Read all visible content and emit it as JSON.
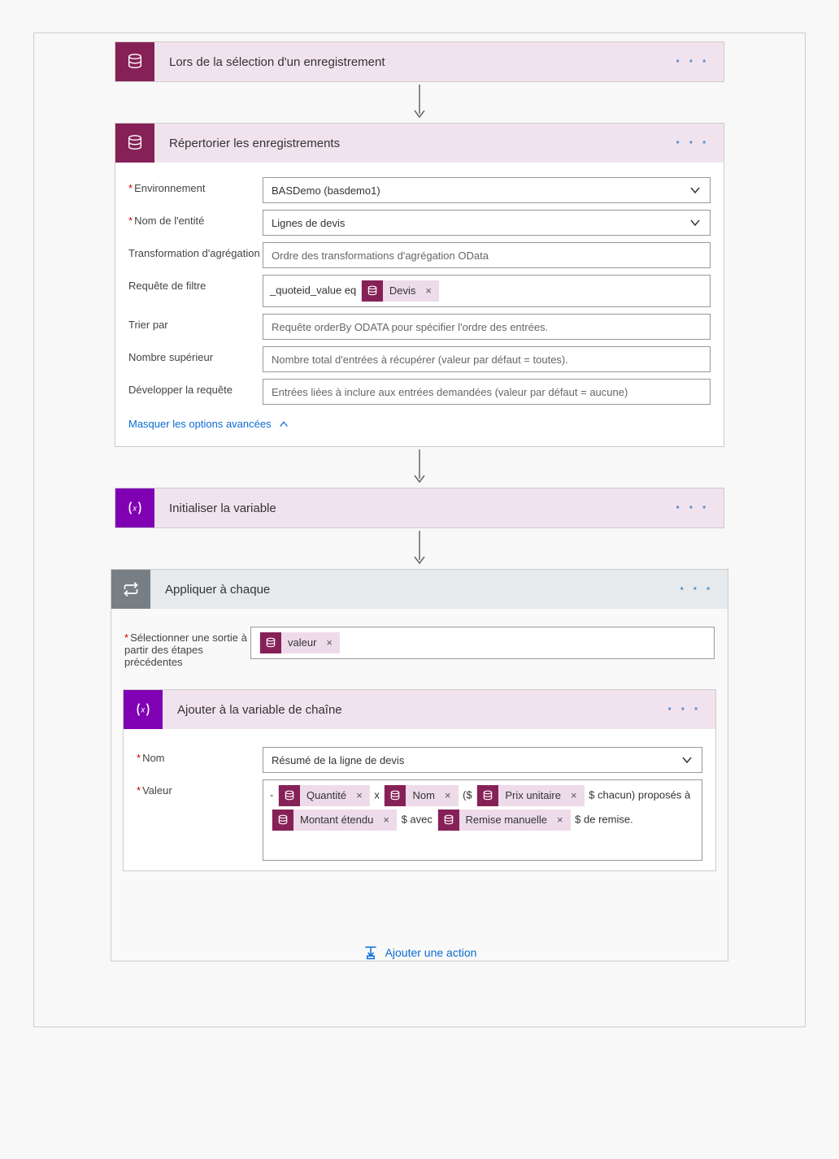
{
  "steps": {
    "trigger": {
      "title": "Lors de la sélection d'un enregistrement"
    },
    "list": {
      "title": "Répertorier les enregistrements",
      "fields": {
        "env_label": "Environnement",
        "env_value": "BASDemo (basdemo1)",
        "entity_label": "Nom de l'entité",
        "entity_value": "Lignes de devis",
        "aggr_label": "Transformation d'agrégation",
        "aggr_placeholder": "Ordre des transformations d'agrégation OData",
        "filter_label": "Requête de filtre",
        "filter_prefix": "_quoteid_value eq",
        "filter_token": "Devis",
        "sort_label": "Trier par",
        "sort_placeholder": "Requête orderBy ODATA pour spécifier l'ordre des entrées.",
        "top_label": "Nombre supérieur",
        "top_placeholder": "Nombre total d'entrées à récupérer (valeur par défaut = toutes).",
        "expand_label": "Développer la requête",
        "expand_placeholder": "Entrées liées à inclure aux entrées demandées (valeur par défaut = aucune)",
        "hide_advanced": "Masquer les options avancées"
      }
    },
    "initvar": {
      "title": "Initialiser la variable"
    },
    "foreach": {
      "title": "Appliquer à chaque",
      "select_label": "Sélectionner une sortie à partir des étapes précédentes",
      "select_token": "valeur"
    },
    "append": {
      "title": "Ajouter à la variable de chaîne",
      "name_label": "Nom",
      "name_value": "Résumé de la ligne de devis",
      "value_label": "Valeur",
      "literals": {
        "dash": "- ",
        "x": " x ",
        "open": " ($",
        "each": " $ chacun) proposés à ",
        "with": " $ avec",
        "remise": " $ de remise."
      },
      "tokens": {
        "qty": "Quantité",
        "name": "Nom",
        "unit": "Prix unitaire",
        "ext": "Montant étendu",
        "discount": "Remise manuelle"
      }
    }
  },
  "footer": {
    "add_action": "Ajouter une action"
  }
}
